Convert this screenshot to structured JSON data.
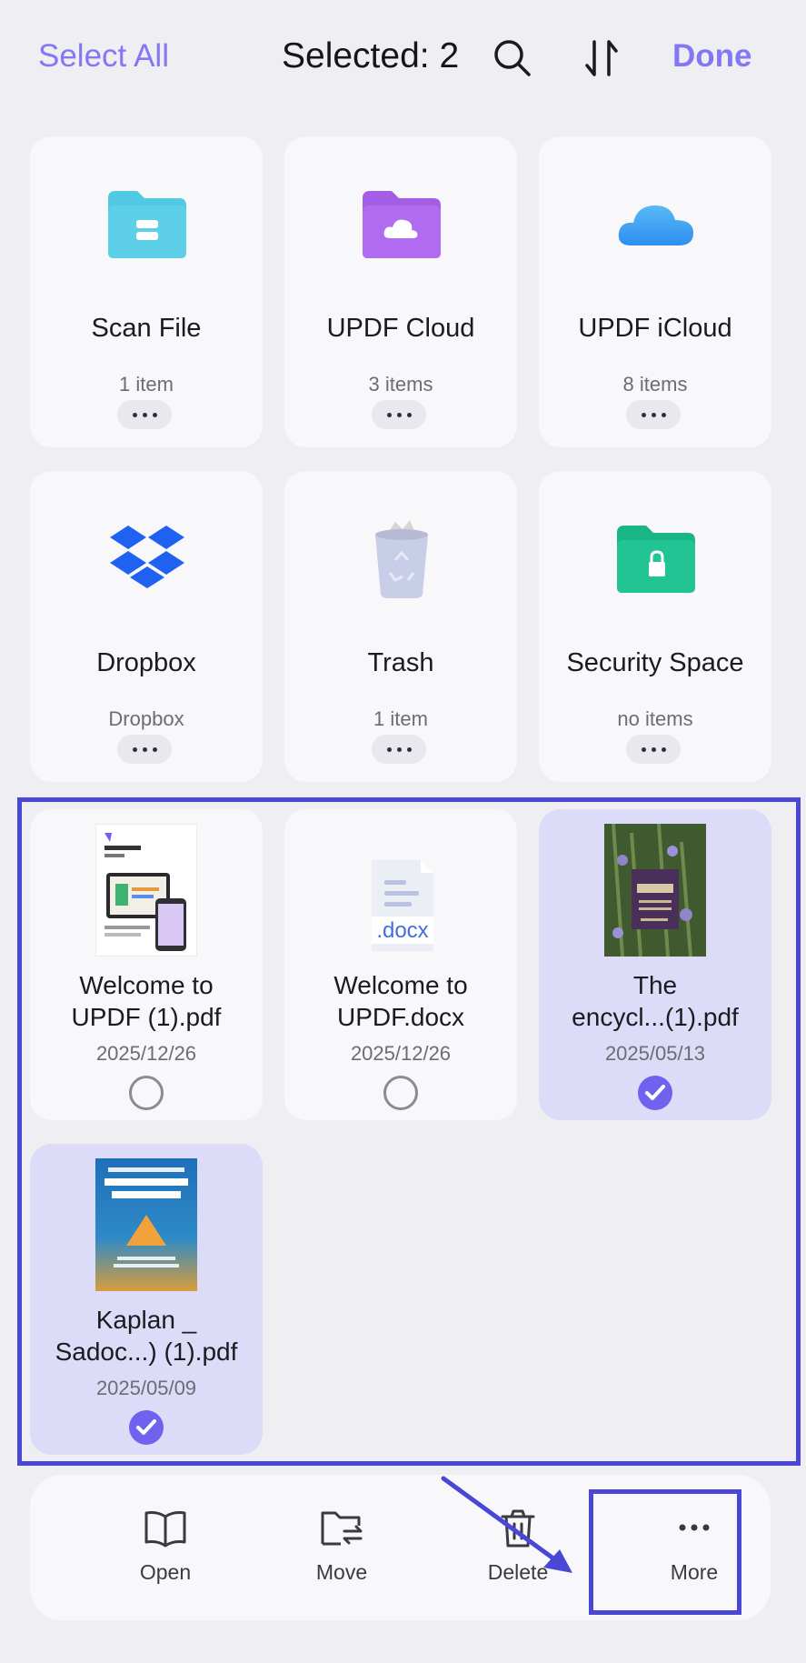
{
  "header": {
    "select_all": "Select All",
    "selected": "Selected: 2",
    "done": "Done"
  },
  "folders": [
    {
      "name": "Scan File",
      "count": "1 item",
      "icon": "scan-folder-icon"
    },
    {
      "name": "UPDF Cloud",
      "count": "3 items",
      "icon": "cloud-folder-icon"
    },
    {
      "name": "UPDF iCloud",
      "count": "8 items",
      "icon": "icloud-icon"
    },
    {
      "name": "Dropbox",
      "count": "Dropbox",
      "icon": "dropbox-icon"
    },
    {
      "name": "Trash",
      "count": "1 item",
      "icon": "trash-bin-icon"
    },
    {
      "name": "Security Space",
      "count": "no items",
      "icon": "lock-folder-icon"
    }
  ],
  "files": [
    {
      "line1": "Welcome to",
      "line2": "UPDF (1).pdf",
      "date": "2025/12/26",
      "selected": false
    },
    {
      "line1": "Welcome to",
      "line2": "UPDF.docx",
      "date": "2025/12/26",
      "selected": false,
      "badge": ".docx"
    },
    {
      "line1": "The",
      "line2": "encycl...(1).pdf",
      "date": "2025/05/13",
      "selected": true
    },
    {
      "line1": "Kaplan _",
      "line2": "Sadoc...) (1).pdf",
      "date": "2025/05/09",
      "selected": true
    }
  ],
  "toolbar": {
    "open": "Open",
    "move": "Move",
    "delete": "Delete",
    "more": "More"
  },
  "colors": {
    "accent": "#8477f4",
    "selected_card": "#dcdcf8",
    "highlight": "#4a46d6"
  }
}
